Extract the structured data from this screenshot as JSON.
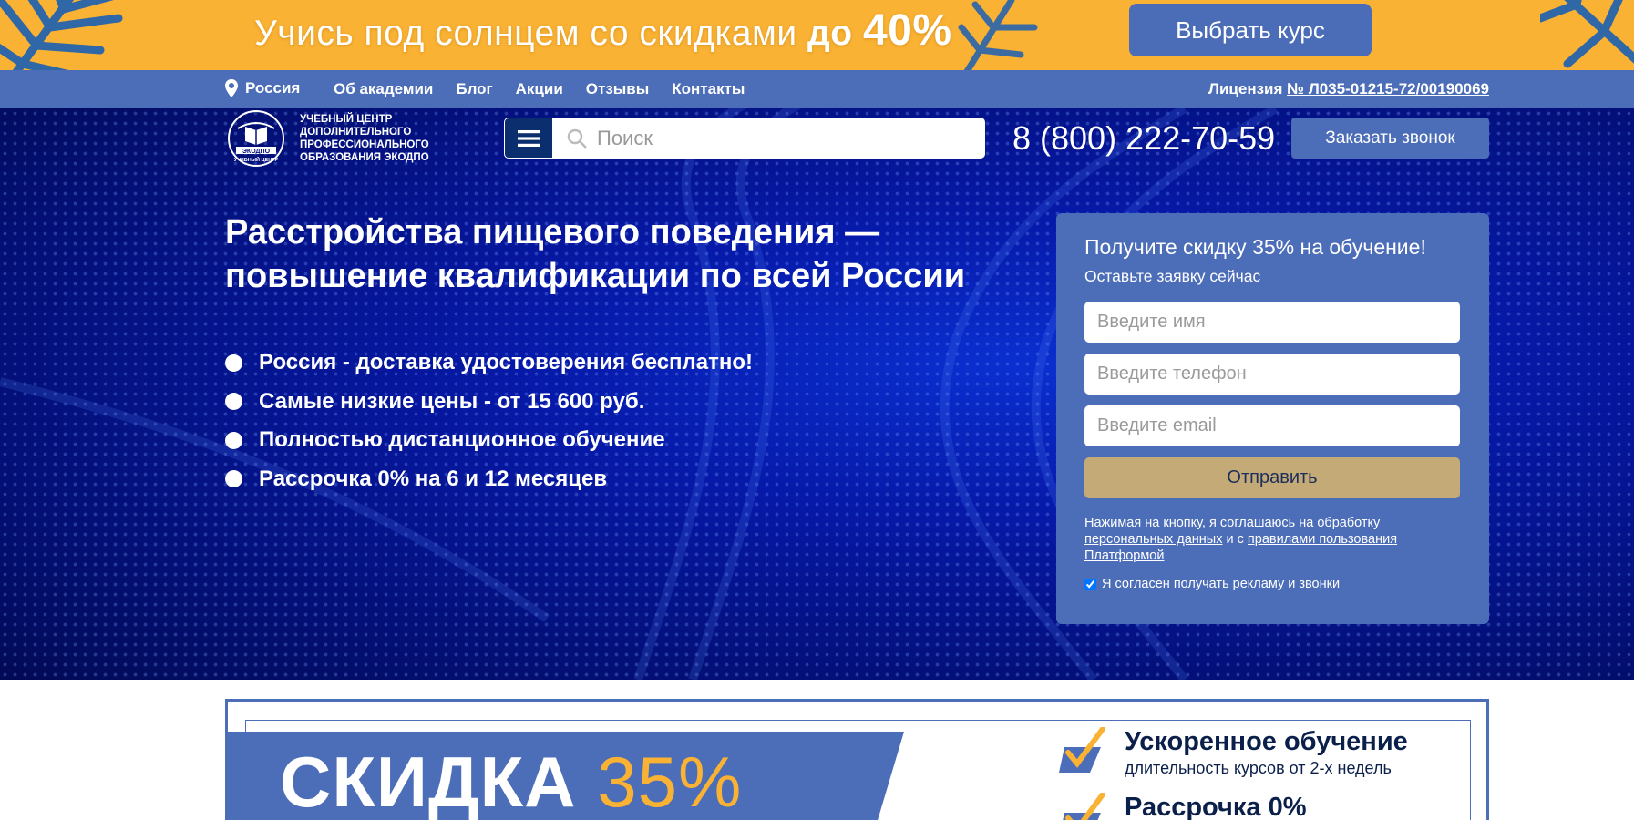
{
  "promo": {
    "text_main": "Учись под солнцем со скидками",
    "text_bold": "до",
    "text_percent": "40%",
    "button_label": "Выбрать курс"
  },
  "nav": {
    "location": "Россия",
    "links": [
      "Об академии",
      "Блог",
      "Акции",
      "Отзывы",
      "Контакты"
    ],
    "license_label": "Лицензия",
    "license_number": "№ Л035-01215-72/00190069"
  },
  "header": {
    "logo_emblem_top": "ЭКОДПО",
    "logo_emblem_bottom": "УЧЕБНЫЙ ЦЕНТР",
    "logo_lines": [
      "Учебный центр",
      "дополнительного",
      "профессионального",
      "образования ЭКОДПО"
    ],
    "search_placeholder": "Поиск",
    "phone": "8 (800) 222-70-59",
    "call_button": "Заказать звонок"
  },
  "hero": {
    "title_line1": "Расстройства пищевого поведения —",
    "title_line2": "повышение квалификации по всей России",
    "bullets": [
      "Россия - доставка удостоверения бесплатно!",
      "Самые низкие цены - от 15 600 руб.",
      "Полностью дистанционное обучение",
      "Рассрочка 0% на 6 и 12 месяцев"
    ]
  },
  "form": {
    "title": "Получите скидку 35% на обучение!",
    "subtitle": "Оставьте заявку сейчас",
    "name_placeholder": "Введите имя",
    "phone_placeholder": "Введите телефон",
    "email_placeholder": "Введите email",
    "submit_label": "Отправить",
    "note_prefix": "Нажимая на кнопку, я соглашаюсь на",
    "note_link1": "обработку персональных данных",
    "note_middle": "и с",
    "note_link2": "правилами пользования Платформой",
    "consent_label": "Я согласен получать рекламу и звонки",
    "consent_checked": true
  },
  "promo_block": {
    "sale_word": "СКИДКА",
    "sale_percent": "35%",
    "features": [
      {
        "title": "Ускоренное обучение",
        "subtitle": "длительность курсов от 2-х недель"
      },
      {
        "title": "Рассрочка 0%",
        "subtitle": ""
      }
    ]
  },
  "colors": {
    "promo_bg": "#f9b233",
    "brand_blue": "#4c6db8",
    "hero_dark": "#03107a",
    "submit_gold": "#c3aa77"
  }
}
